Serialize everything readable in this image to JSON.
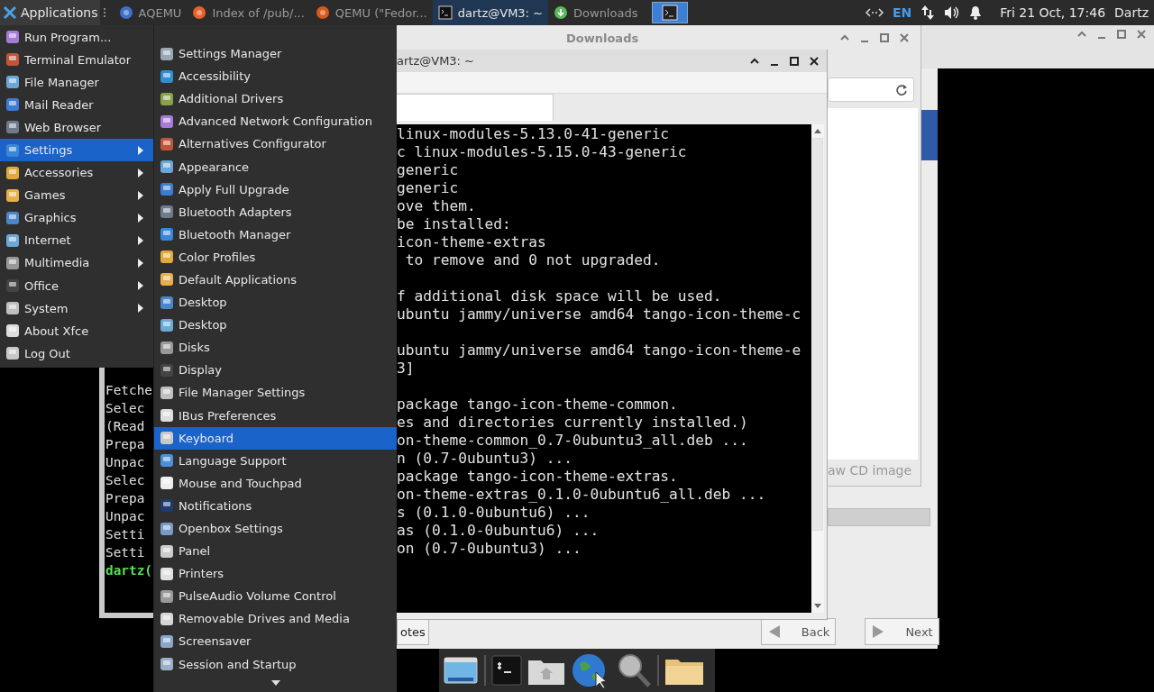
{
  "panel": {
    "apps_button": "Applications",
    "tasks": [
      {
        "label": "AQEMU",
        "selected": false
      },
      {
        "label": "Index of /pub/...",
        "selected": false
      },
      {
        "label": "QEMU (\"Fedor...",
        "selected": false
      },
      {
        "label": "dartz@VM3: ~",
        "selected": true
      },
      {
        "label": "Downloads",
        "selected": false
      }
    ],
    "keyboard_layout": "EN",
    "clock": "Fri 21 Oct, 17:46",
    "user": "Dartz"
  },
  "app_menu": {
    "items": [
      {
        "label": "Run Program...",
        "has_submenu": false,
        "selected": false
      },
      {
        "label": "Terminal Emulator",
        "has_submenu": false,
        "selected": false
      },
      {
        "label": "File Manager",
        "has_submenu": false,
        "selected": false
      },
      {
        "label": "Mail Reader",
        "has_submenu": false,
        "selected": false
      },
      {
        "label": "Web Browser",
        "has_submenu": false,
        "selected": false
      },
      {
        "label": "Settings",
        "has_submenu": true,
        "selected": true
      },
      {
        "label": "Accessories",
        "has_submenu": true,
        "selected": false
      },
      {
        "label": "Games",
        "has_submenu": true,
        "selected": false
      },
      {
        "label": "Graphics",
        "has_submenu": true,
        "selected": false
      },
      {
        "label": "Internet",
        "has_submenu": true,
        "selected": false
      },
      {
        "label": "Multimedia",
        "has_submenu": true,
        "selected": false
      },
      {
        "label": "Office",
        "has_submenu": true,
        "selected": false
      },
      {
        "label": "System",
        "has_submenu": true,
        "selected": false
      },
      {
        "label": "About Xfce",
        "has_submenu": false,
        "selected": false
      },
      {
        "label": "Log Out",
        "has_submenu": false,
        "selected": false
      }
    ]
  },
  "settings_submenu": {
    "items": [
      {
        "label": "Settings Manager",
        "selected": false
      },
      {
        "label": "Accessibility",
        "selected": false
      },
      {
        "label": "Additional Drivers",
        "selected": false
      },
      {
        "label": "Advanced Network Configuration",
        "selected": false
      },
      {
        "label": "Alternatives Configurator",
        "selected": false
      },
      {
        "label": "Appearance",
        "selected": false
      },
      {
        "label": "Apply Full Upgrade",
        "selected": false
      },
      {
        "label": "Bluetooth Adapters",
        "selected": false
      },
      {
        "label": "Bluetooth Manager",
        "selected": false
      },
      {
        "label": "Color Profiles",
        "selected": false
      },
      {
        "label": "Default Applications",
        "selected": false
      },
      {
        "label": "Desktop",
        "selected": false
      },
      {
        "label": "Desktop",
        "selected": false
      },
      {
        "label": "Disks",
        "selected": false
      },
      {
        "label": "Display",
        "selected": false
      },
      {
        "label": "File Manager Settings",
        "selected": false
      },
      {
        "label": "IBus Preferences",
        "selected": false
      },
      {
        "label": "Keyboard",
        "selected": true
      },
      {
        "label": "Language Support",
        "selected": false
      },
      {
        "label": "Mouse and Touchpad",
        "selected": false
      },
      {
        "label": "Notifications",
        "selected": false
      },
      {
        "label": "Openbox Settings",
        "selected": false
      },
      {
        "label": "Panel",
        "selected": false
      },
      {
        "label": "Printers",
        "selected": false
      },
      {
        "label": "PulseAudio Volume Control",
        "selected": false
      },
      {
        "label": "Removable Drives and Media",
        "selected": false
      },
      {
        "label": "Screensaver",
        "selected": false
      },
      {
        "label": "Session and Startup",
        "selected": false
      }
    ]
  },
  "left_terminal": {
    "lines": [
      {
        "text": "Fetche",
        "kind": "output"
      },
      {
        "text": "Selec",
        "kind": "output"
      },
      {
        "text": "(Read",
        "kind": "output"
      },
      {
        "text": "Prepa",
        "kind": "output"
      },
      {
        "text": "Unpac",
        "kind": "output"
      },
      {
        "text": "Selec",
        "kind": "output"
      },
      {
        "text": "Prepa",
        "kind": "output"
      },
      {
        "text": "Unpac",
        "kind": "output"
      },
      {
        "text": "Setti",
        "kind": "output"
      },
      {
        "text": "Setti",
        "kind": "output"
      },
      {
        "text": "dartz(",
        "kind": "prompt"
      }
    ]
  },
  "downloads_window": {
    "title": "Downloads",
    "status_text": "aw CD image"
  },
  "terminal_window": {
    "title": "artz@VM3: ~",
    "lines": [
      {
        "kind": "text",
        "text": "linux-modules-5.13.0-41-generic"
      },
      {
        "kind": "text",
        "text": "c linux-modules-5.15.0-43-generic"
      },
      {
        "kind": "text",
        "text": "generic"
      },
      {
        "kind": "text",
        "text": "generic"
      },
      {
        "kind": "text",
        "text": "ove them."
      },
      {
        "kind": "text",
        "text": "be installed:"
      },
      {
        "kind": "text",
        "text": "icon-theme-extras"
      },
      {
        "kind": "text",
        "text": " to remove and 0 not upgraded."
      },
      {
        "kind": "blank"
      },
      {
        "kind": "text",
        "text": "f additional disk space will be used."
      },
      {
        "kind": "text",
        "text": "ubuntu jammy/universe amd64 tango-icon-theme-c"
      },
      {
        "kind": "blank"
      },
      {
        "kind": "text",
        "text": "ubuntu jammy/universe amd64 tango-icon-theme-e"
      },
      {
        "kind": "text",
        "text": "3]"
      },
      {
        "kind": "blank"
      },
      {
        "kind": "text",
        "text": "package tango-icon-theme-common."
      },
      {
        "kind": "text",
        "text": "es and directories currently installed.)"
      },
      {
        "kind": "text",
        "text": "on-theme-common_0.7-0ubuntu3_all.deb ..."
      },
      {
        "kind": "text",
        "text": "n (0.7-0ubuntu3) ..."
      },
      {
        "kind": "text",
        "text": "package tango-icon-theme-extras."
      },
      {
        "kind": "text",
        "text": "on-theme-extras_0.1.0-0ubuntu6_all.deb ..."
      },
      {
        "kind": "text",
        "text": "s (0.1.0-0ubuntu6) ..."
      },
      {
        "kind": "text",
        "text": "as (0.1.0-0ubuntu6) ..."
      },
      {
        "kind": "text",
        "text": "on (0.7-0ubuntu3) ..."
      }
    ]
  },
  "wizard": {
    "buttons": [
      {
        "label": "otes",
        "kind": "plain"
      },
      {
        "label": "Back",
        "kind": "back"
      },
      {
        "label": "Next",
        "kind": "next"
      }
    ]
  }
}
